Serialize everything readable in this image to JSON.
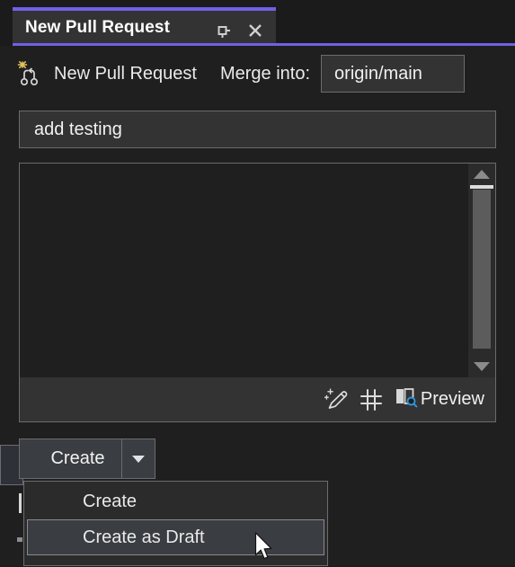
{
  "window": {
    "tab_title": "New Pull Request",
    "pin_icon": "pin-icon",
    "close_icon": "close-icon",
    "accent_color": "#7160e8"
  },
  "header": {
    "icon": "new-pull-request-icon",
    "title": "New Pull Request",
    "merge_label": "Merge into:",
    "merge_target": "origin/main"
  },
  "form": {
    "title_value": "add testing",
    "title_placeholder": "Title",
    "description_value": "",
    "description_placeholder": "",
    "toolbar": {
      "generate_icon": "sparkle-pen-icon",
      "heading_icon": "hash-icon",
      "preview_icon": "preview-split-pane-icon",
      "preview_label": "Preview"
    },
    "scrollbar": {
      "up_icon": "scroll-up-arrow-icon",
      "down_icon": "scroll-down-arrow-icon"
    }
  },
  "actions": {
    "create_label": "Create",
    "dropdown_icon": "chevron-down-icon",
    "menu": [
      {
        "label": "Create",
        "selected": false
      },
      {
        "label": "Create as Draft",
        "selected": true
      }
    ]
  },
  "pointer": {
    "icon": "mouse-arrow-cursor"
  }
}
